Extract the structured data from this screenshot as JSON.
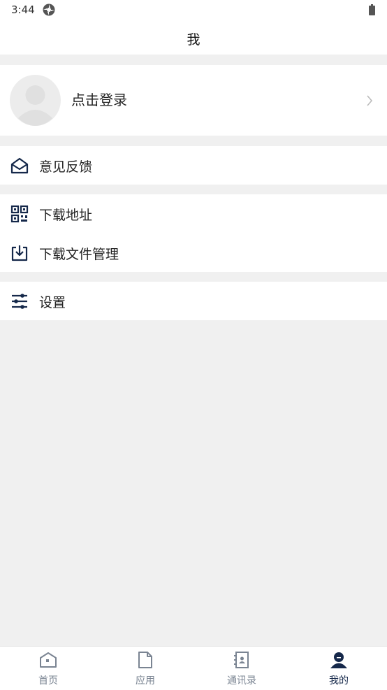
{
  "status_bar": {
    "time": "3:44"
  },
  "header": {
    "title": "我"
  },
  "profile": {
    "login_label": "点击登录"
  },
  "menu": {
    "feedback": {
      "label": "意见反馈",
      "icon": "mail-open-icon"
    },
    "download_address": {
      "label": "下载地址",
      "icon": "qr-code-icon"
    },
    "download_files": {
      "label": "下载文件管理",
      "icon": "download-icon"
    },
    "settings": {
      "label": "设置",
      "icon": "sliders-icon"
    }
  },
  "tabbar": {
    "items": [
      {
        "label": "首页",
        "icon": "home-icon",
        "active": false
      },
      {
        "label": "应用",
        "icon": "document-icon",
        "active": false
      },
      {
        "label": "通讯录",
        "icon": "contacts-book-icon",
        "active": false
      },
      {
        "label": "我的",
        "icon": "user-icon",
        "active": true
      }
    ]
  },
  "colors": {
    "icon_dark": "#15284a",
    "tab_inactive": "#7a8492",
    "background": "#f0f0f0"
  }
}
